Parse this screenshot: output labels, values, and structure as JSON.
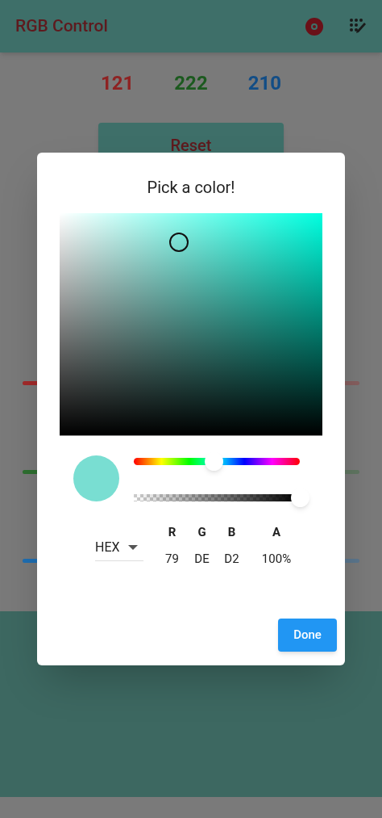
{
  "app_bar": {
    "title": "RGB Control"
  },
  "values": [
    {
      "text": "121",
      "color": "#8e2222"
    },
    {
      "text": "222",
      "color": "#1c5a1f"
    },
    {
      "text": "210",
      "color": "#124d86"
    }
  ],
  "reset_button": {
    "label": "Reset"
  },
  "sliders": [
    {
      "color": "#a32a2a",
      "level": 0.47
    },
    {
      "color": "#2e7030",
      "level": 0.87
    },
    {
      "color": "#1f6fb3",
      "level": 0.82
    }
  ],
  "dialog": {
    "title": "Pick a color!",
    "hue_slider": {
      "level": 0.48
    },
    "alpha_slider": {
      "level": 1
    },
    "format_dropdown": {
      "value": "HEX"
    },
    "channels": [
      {
        "label": "R",
        "value": "79"
      },
      {
        "label": "G",
        "value": "DE"
      },
      {
        "label": "B",
        "value": "D2"
      },
      {
        "label": "A",
        "value": "100%"
      }
    ],
    "done_button": {
      "label": "Done"
    }
  }
}
